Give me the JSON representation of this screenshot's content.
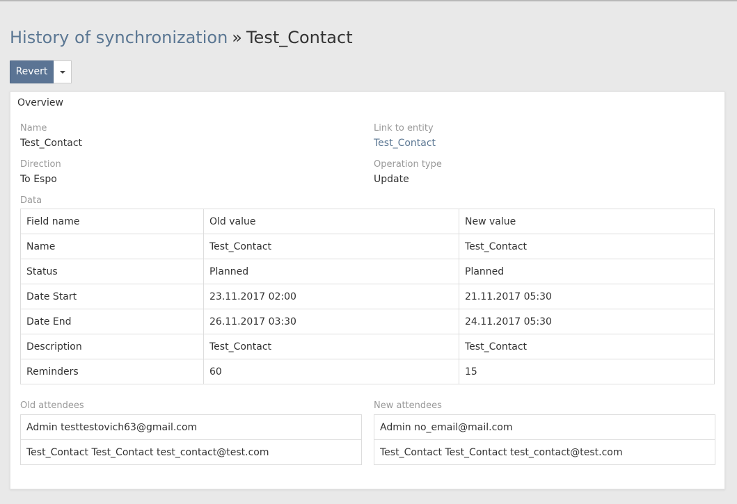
{
  "breadcrumb": {
    "parent": "History of synchronization",
    "separator": "»",
    "current": "Test_Contact"
  },
  "actions": {
    "revert_label": "Revert"
  },
  "panel": {
    "title": "Overview",
    "fields": {
      "name": {
        "label": "Name",
        "value": "Test_Contact"
      },
      "link": {
        "label": "Link to entity",
        "value": "Test_Contact"
      },
      "direction": {
        "label": "Direction",
        "value": "To Espo"
      },
      "operation": {
        "label": "Operation type",
        "value": "Update"
      }
    },
    "data_label": "Data",
    "table": {
      "headers": [
        "Field name",
        "Old value",
        "New value"
      ],
      "rows": [
        [
          "Name",
          "Test_Contact",
          "Test_Contact"
        ],
        [
          "Status",
          "Planned",
          "Planned"
        ],
        [
          "Date Start",
          "23.11.2017 02:00",
          "21.11.2017 05:30"
        ],
        [
          "Date End",
          "26.11.2017 03:30",
          "24.11.2017 05:30"
        ],
        [
          "Description",
          "Test_Contact",
          "Test_Contact"
        ],
        [
          "Reminders",
          "60",
          "15"
        ]
      ]
    },
    "old_attendees": {
      "label": "Old attendees",
      "items": [
        "Admin testtestovich63@gmail.com",
        "Test_Contact Test_Contact test_contact@test.com"
      ]
    },
    "new_attendees": {
      "label": "New attendees",
      "items": [
        "Admin no_email@mail.com",
        "Test_Contact Test_Contact test_contact@test.com"
      ]
    }
  },
  "colors": {
    "accent": "#5b7494",
    "link": "#5b7793",
    "background": "#e9e9e9"
  }
}
